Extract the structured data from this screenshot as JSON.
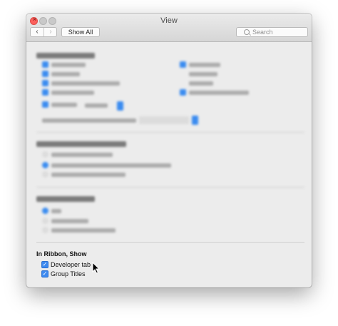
{
  "window": {
    "title": "View"
  },
  "toolbar": {
    "back_icon": "chevron-left-icon",
    "forward_icon": "chevron-right-icon",
    "show_all_label": "Show All",
    "search_placeholder": "Search"
  },
  "ribbon_section": {
    "heading": "In Ribbon, Show",
    "options": [
      {
        "label": "Developer tab",
        "checked": true
      },
      {
        "label": "Group Titles",
        "checked": true
      }
    ]
  },
  "colors": {
    "accent": "#3d8af0",
    "close_button": "#fc605c",
    "window_bg": "#ececec"
  }
}
